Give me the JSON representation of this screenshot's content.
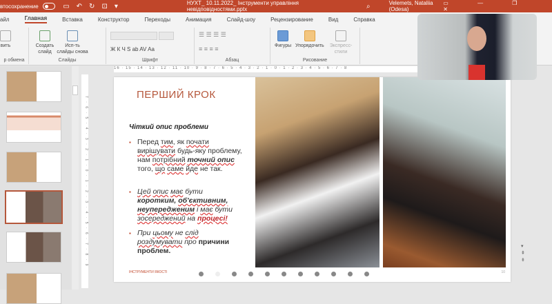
{
  "titlebar": {
    "autosave_label": "втосохранение",
    "file_name": "НУХТ_ 10.11.2022_ Інструменти управління невідповідностями.pptx",
    "user_name": "Velemets, Nataliia (Odesa)"
  },
  "tabs": [
    "айл",
    "Главная",
    "Вставка",
    "Конструктор",
    "Переходы",
    "Анимация",
    "Слайд-шоу",
    "Рецензирование",
    "Вид",
    "Справка"
  ],
  "ribbon": {
    "clipboard_label": "р обмена",
    "clipboard_paste": "вить",
    "new_slide": "Создать слайд",
    "reuse_slides": "Исп-ть слайды снова",
    "slides_label": "Слайды",
    "font_label": "Шрифт",
    "font_buttons": "Ж  К  Ч  S  ab  AV  Aa",
    "paragraph_label": "Абзац",
    "shapes": "Фигуры",
    "arrange": "Упорядочить",
    "quick_styles": "Экспресс-стили",
    "drawing_label": "Рисование"
  },
  "ruler": {
    "horizontal": "16 · 15 · 14 · 13 · 12 · 11 · 10 · 9 · 8 · 7 · 6 · 5 · 4 · 3 · 2 · 1 · 0 · 1 · 2 · 3 · 4 · 5 · 6 · 7 · 8",
    "vertical": "7 · 6 · 5 · 4 · 3 · 2 · 1 · 0 · 1 · 2 · 3 · 4 · 5 · 6 · 7 · 8 · 9"
  },
  "slide": {
    "title": "ПЕРШИЙ КРОК",
    "subtitle": "Чіткий опис проблеми",
    "bullet1": {
      "a": "Перед ",
      "b": "тим",
      ", ": "",
      "c": ", як ",
      "d": "почати",
      "e": "вирішувати",
      "f": " будь-яку проблему, нам ",
      "g": "потрібний",
      "h": "точний опис",
      "i": " того, ",
      "j": "що",
      "k": " ",
      "l": "саме",
      "m": "йде",
      "n": " не так."
    },
    "bullet2": {
      "a": "Цей",
      "b": "опис",
      "c": "має",
      "d": " бути ",
      "e": "коротким, ",
      "f": "об'єктивним,",
      "g": "неупередженим",
      "h": " і ",
      "i": "має",
      "j": " бути ",
      "k": "зосереджений",
      "l": " на ",
      "m": "процесі!"
    },
    "bullet3": {
      "a": "При ",
      "b": "цьому",
      "c": " не ",
      "d": "слід",
      "e": "роздумувати",
      "f": " про ",
      "g": "причини проблем."
    },
    "footer": "ІНСТРУМЕНТИ ЯКОСТІ",
    "page_number": "10"
  },
  "colors": {
    "accent": "#c0462a",
    "title": "#b5573b"
  }
}
